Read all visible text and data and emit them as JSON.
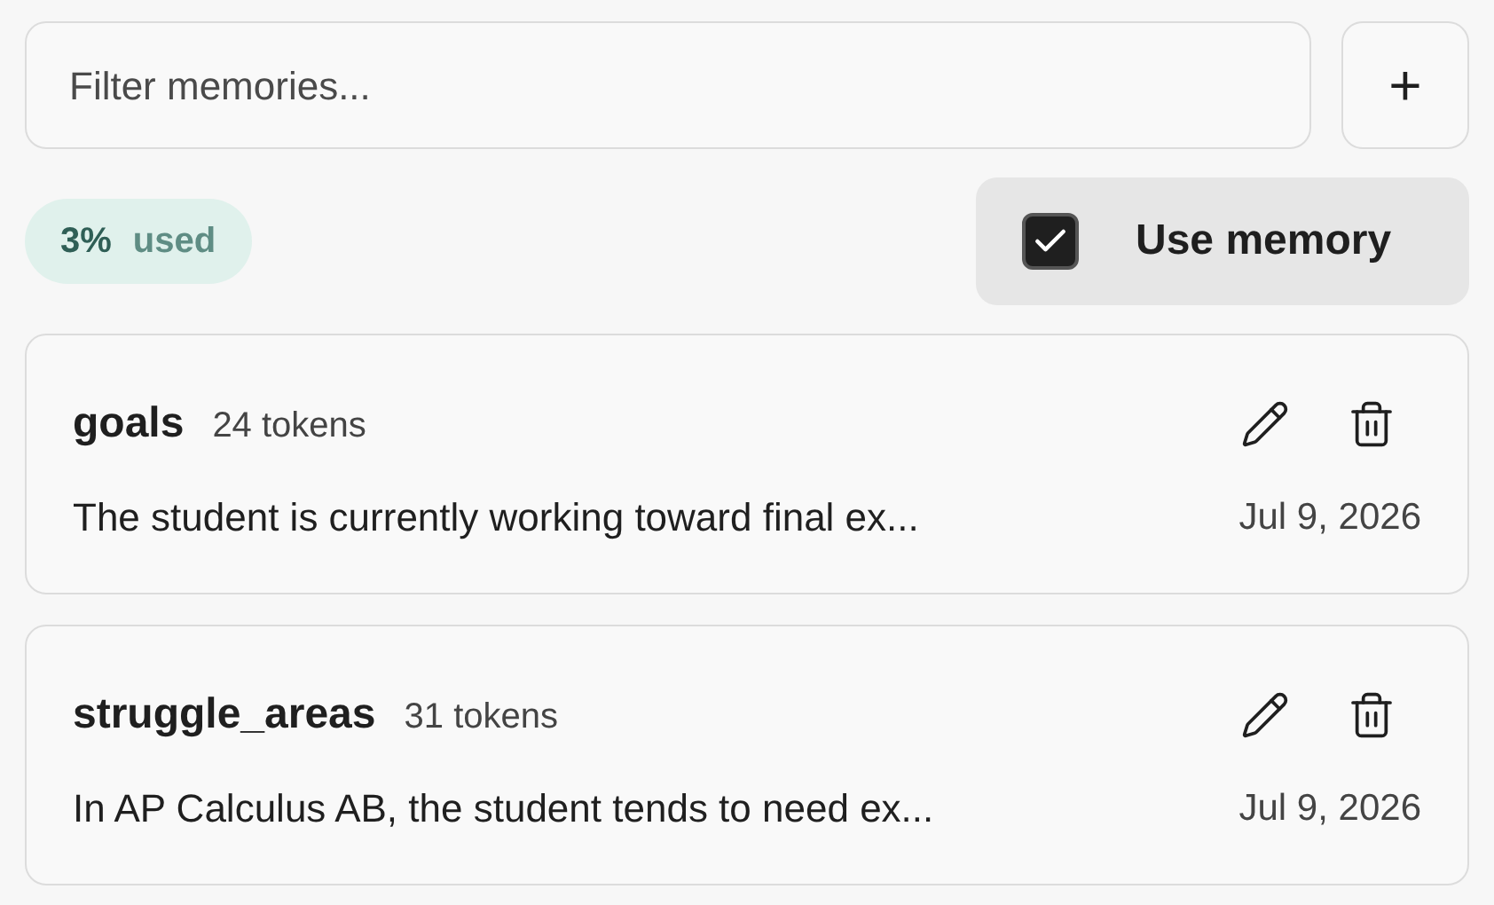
{
  "filter": {
    "placeholder": "Filter memories..."
  },
  "add_button": {
    "label": "+"
  },
  "usage": {
    "percent": "3%",
    "label": "used"
  },
  "use_memory": {
    "label": "Use memory",
    "checked": true
  },
  "memories": [
    {
      "title": "goals",
      "tokens": "24 tokens",
      "text": "The student is currently working toward final ex...",
      "date": "Jul 9, 2026"
    },
    {
      "title": "struggle_areas",
      "tokens": "31 tokens",
      "text": "In AP Calculus AB, the student tends to need ex...",
      "date": "Jul 9, 2026"
    }
  ]
}
